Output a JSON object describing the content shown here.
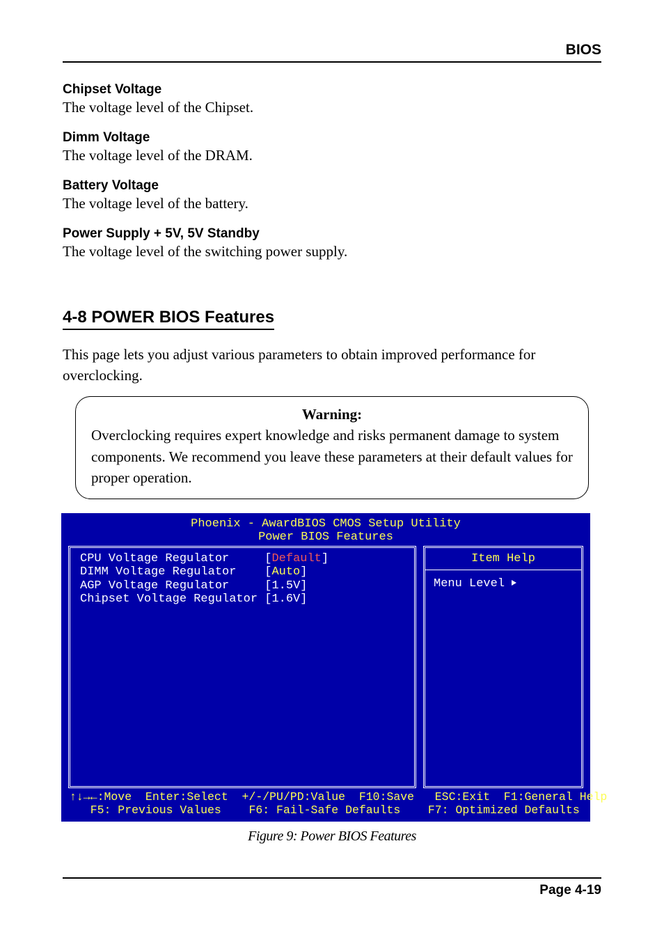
{
  "header": {
    "title": "BIOS"
  },
  "defs": [
    {
      "title": "Chipset Voltage",
      "body": "The voltage level of the Chipset."
    },
    {
      "title": "Dimm Voltage",
      "body": "The voltage level of the DRAM."
    },
    {
      "title": "Battery Voltage",
      "body": "The voltage level of the battery."
    },
    {
      "title": "Power Supply + 5V, 5V Standby",
      "body": "The voltage level of the switching power supply."
    }
  ],
  "section": {
    "heading": "4-8 POWER BIOS Features",
    "body": "This page lets you adjust various parameters to obtain improved performance for overclocking."
  },
  "warning": {
    "label": "Warning",
    "text": "Overclocking requires expert knowledge and risks permanent damage to system components. We recommend you leave these parameters at their default values for proper operation."
  },
  "bios": {
    "title_line1": "Phoenix - AwardBIOS CMOS Setup Utility",
    "title_line2": "Power BIOS Features",
    "items": [
      {
        "label": "CPU Voltage Regulator",
        "value": "Default",
        "highlight": "red"
      },
      {
        "label": "DIMM Voltage Regulator",
        "value": "Auto",
        "highlight": "yellow"
      },
      {
        "label": "AGP Voltage Regulator",
        "value": "1.5V",
        "highlight": "white"
      },
      {
        "label": "Chipset Voltage Regulator",
        "value": "1.6V",
        "highlight": "white"
      }
    ],
    "help_title": "Item Help",
    "menu_level": "Menu Level",
    "footer_line1": "↑↓→←:Move  Enter:Select  +/-/PU/PD:Value  F10:Save   ESC:Exit  F1:General Help",
    "footer_line2": "   F5: Previous Values    F6: Fail-Safe Defaults    F7: Optimized Defaults"
  },
  "figure_caption": "Figure 9: Power BIOS Features",
  "page_number": "Page 4-19"
}
